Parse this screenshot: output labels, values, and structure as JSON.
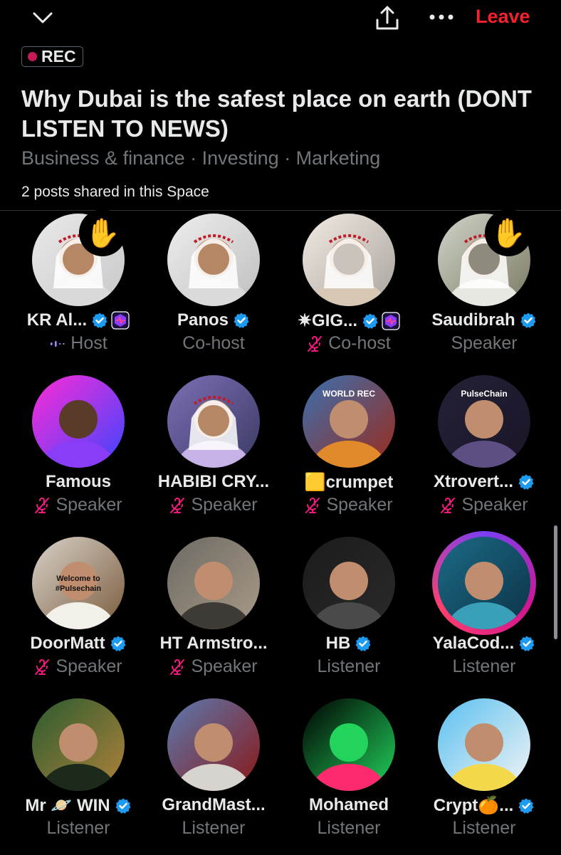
{
  "header": {
    "leave_label": "Leave",
    "rec_label": "REC",
    "title": "Why Dubai is the safest place on earth (DONT LISTEN TO NEWS)",
    "topics": "Business & finance · Investing · Marketing",
    "posts_shared": "2 posts shared in this Space"
  },
  "icons": {
    "collapse": "chevron-down-icon",
    "share": "share-icon",
    "more": "more-icon",
    "raised_hand": "raised-hand-icon",
    "verified": "verified-badge-icon",
    "muted": "mic-off-icon",
    "speaking": "audio-bars-icon"
  },
  "colors": {
    "leave": "#f4212e",
    "verified": "#1d9bf0",
    "muted": "#f91880",
    "role": "#71767b",
    "rec_dot": "#c51a5a"
  },
  "participants": [
    {
      "name": "KR Al...",
      "role": "Host",
      "verified": true,
      "pulse_tag": true,
      "muted": false,
      "speaking": true,
      "hand_raised": true
    },
    {
      "name": "Panos",
      "role": "Co-host",
      "verified": true,
      "pulse_tag": false,
      "muted": false,
      "speaking": false,
      "hand_raised": false
    },
    {
      "name": "✷GIG...",
      "role": "Co-host",
      "verified": true,
      "pulse_tag": true,
      "muted": true,
      "speaking": false,
      "hand_raised": false
    },
    {
      "name": "Saudibrah",
      "role": "Speaker",
      "verified": true,
      "pulse_tag": false,
      "muted": false,
      "speaking": false,
      "hand_raised": true
    },
    {
      "name": "Famous",
      "role": "Speaker",
      "verified": false,
      "pulse_tag": false,
      "muted": true,
      "speaking": false,
      "hand_raised": false
    },
    {
      "name": "HABIBI CRY...",
      "role": "Speaker",
      "verified": false,
      "pulse_tag": false,
      "muted": true,
      "speaking": false,
      "hand_raised": false
    },
    {
      "name": "🟨crumpet",
      "role": "Speaker",
      "verified": false,
      "pulse_tag": false,
      "muted": true,
      "speaking": false,
      "hand_raised": false
    },
    {
      "name": "Xtrovert...",
      "role": "Speaker",
      "verified": true,
      "pulse_tag": false,
      "muted": true,
      "speaking": false,
      "hand_raised": false
    },
    {
      "name": "DoorMatt",
      "role": "Speaker",
      "verified": true,
      "pulse_tag": false,
      "muted": true,
      "speaking": false,
      "hand_raised": false
    },
    {
      "name": "HT Armstro...",
      "role": "Speaker",
      "verified": false,
      "pulse_tag": false,
      "muted": true,
      "speaking": false,
      "hand_raised": false
    },
    {
      "name": "HB",
      "role": "Listener",
      "verified": true,
      "pulse_tag": false,
      "muted": false,
      "speaking": false,
      "hand_raised": false
    },
    {
      "name": "YalaCod...",
      "role": "Listener",
      "verified": true,
      "pulse_tag": false,
      "muted": false,
      "speaking": false,
      "hand_raised": false,
      "ringed": true
    },
    {
      "name": "Mr 🪐 WIN",
      "role": "Listener",
      "verified": true,
      "pulse_tag": false,
      "muted": false,
      "speaking": false,
      "hand_raised": false
    },
    {
      "name": "GrandMast...",
      "role": "Listener",
      "verified": false,
      "pulse_tag": false,
      "muted": false,
      "speaking": false,
      "hand_raised": false
    },
    {
      "name": "Mohamed",
      "role": "Listener",
      "verified": false,
      "pulse_tag": false,
      "muted": false,
      "speaking": false,
      "hand_raised": false
    },
    {
      "name": "Crypt🍊...",
      "role": "Listener",
      "verified": true,
      "pulse_tag": false,
      "muted": false,
      "speaking": false,
      "hand_raised": false
    }
  ],
  "avatar_art": [
    {
      "text": "",
      "note": ""
    },
    {
      "text": "",
      "note": ""
    },
    {
      "text": "",
      "note": ""
    },
    {
      "text": "",
      "note": ""
    },
    {
      "text": "",
      "note": ""
    },
    {
      "text": "",
      "note": ""
    },
    {
      "text": "WORLD REC",
      "note": ""
    },
    {
      "text": "PulseChain",
      "note": ""
    },
    {
      "text": "Welcome to",
      "note": "#Pulsechain"
    },
    {
      "text": "",
      "note": ""
    },
    {
      "text": "",
      "note": ""
    },
    {
      "text": "",
      "note": ""
    },
    {
      "text": "",
      "note": ""
    },
    {
      "text": "",
      "note": ""
    },
    {
      "text": "",
      "note": ""
    },
    {
      "text": "",
      "note": ""
    }
  ]
}
